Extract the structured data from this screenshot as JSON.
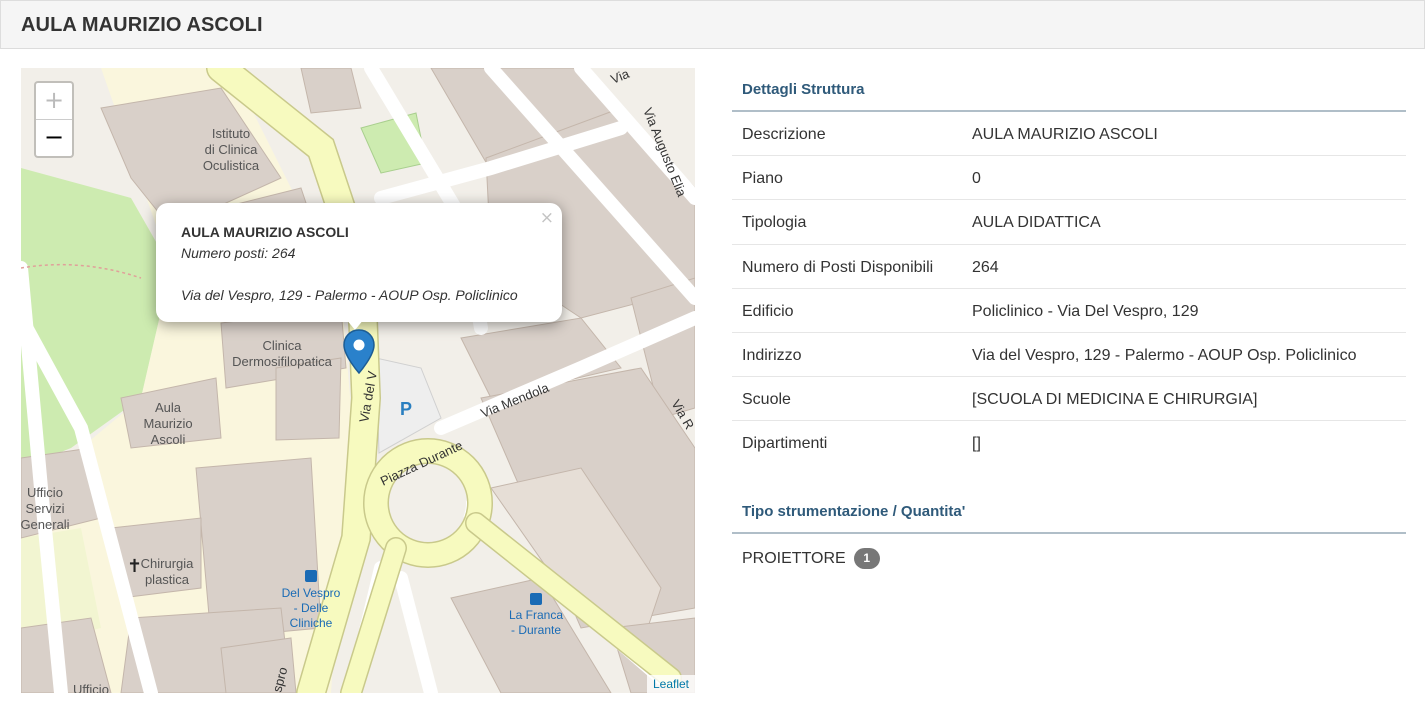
{
  "page": {
    "title": "AULA MAURIZIO ASCOLI"
  },
  "map": {
    "zoom_in": "+",
    "zoom_out": "−",
    "attribution": "Leaflet",
    "labels": {
      "istituto": "Istituto",
      "di_clinica": "di Clinica",
      "oculistica": "Oculistica",
      "clinica": "Clinica",
      "dermosifilopatica": "Dermosifilopatica",
      "aula": "Aula",
      "maurizio": "Maurizio",
      "ascoli": "Ascoli",
      "ufficio": "Ufficio",
      "servizi": "Servizi",
      "generali": "Generali",
      "chirurgia": "Chirurgia",
      "plastica": "plastica",
      "del_vespro": "Del Vespro",
      "delle": "- Delle",
      "cliniche": "Cliniche",
      "la_franca": "La Franca",
      "durante": "- Durante",
      "via_mendola": "Via Mendola",
      "piazza_durante": "Piazza Durante",
      "via_del_vespro": "Via del V",
      "via_augusto_elia": "Via Augusto Elia",
      "via_top": "Via",
      "via_r": "Via R",
      "parking": "P",
      "ufficio_bottom": "Ufficio",
      "spro": "spro"
    },
    "popup": {
      "close": "×",
      "title": "AULA MAURIZIO ASCOLI",
      "seats": "Numero posti: 264",
      "address": "Via del Vespro, 129 - Palermo - AOUP Osp. Policlinico"
    }
  },
  "details": {
    "section_title": "Dettagli Struttura",
    "rows": [
      {
        "key": "Descrizione",
        "value": "AULA MAURIZIO ASCOLI"
      },
      {
        "key": "Piano",
        "value": "0"
      },
      {
        "key": "Tipologia",
        "value": "AULA DIDATTICA"
      },
      {
        "key": "Numero di Posti Disponibili",
        "value": "264"
      },
      {
        "key": "Edificio",
        "value": "Policlinico - Via Del Vespro, 129"
      },
      {
        "key": "Indirizzo",
        "value": "Via del Vespro, 129 - Palermo - AOUP Osp. Policlinico"
      },
      {
        "key": "Scuole",
        "value": "[SCUOLA DI MEDICINA E CHIRURGIA]"
      },
      {
        "key": "Dipartimenti",
        "value": "[]"
      }
    ]
  },
  "instruments": {
    "section_title": "Tipo strumentazione / Quantita'",
    "items": [
      {
        "name": "PROIETTORE",
        "qty": "1"
      }
    ]
  },
  "colors": {
    "accent": "#2f5a7a",
    "marker": "#2a81cb",
    "road_major": "#f7fabf",
    "building": "#d9d0c9"
  }
}
